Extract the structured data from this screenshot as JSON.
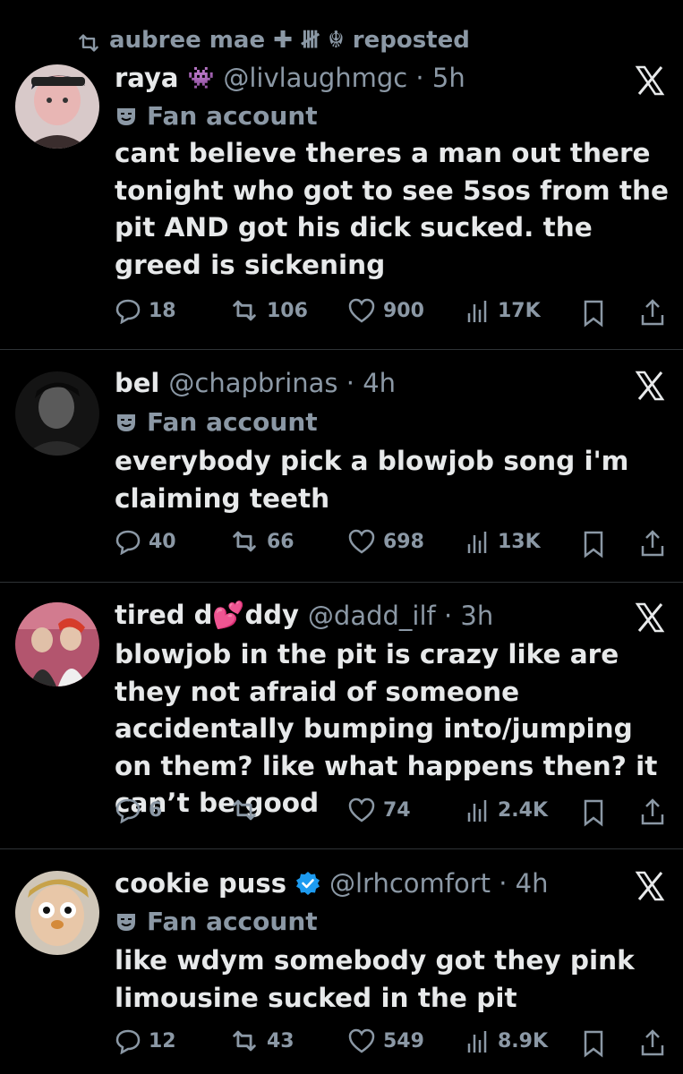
{
  "repost_banner": {
    "text": "aubree mae ✚ 𝍸 ☬ reposted"
  },
  "tweets": [
    {
      "name": "raya",
      "name_emoji": "👾",
      "handle": "@livlaughmgc",
      "time": "5h",
      "fan_label": "Fan account",
      "text": "cant believe theres a man out there tonight who got to see 5sos from the pit AND got his dick sucked. the greed is sickening",
      "replies": "18",
      "reposts": "106",
      "likes": "900",
      "views": "17K"
    },
    {
      "name": "bel",
      "handle": "@chapbrinas",
      "time": "4h",
      "fan_label": "Fan account",
      "text": "everybody pick a blowjob song i'm claiming teeth",
      "replies": "40",
      "reposts": "66",
      "likes": "698",
      "views": "13K"
    },
    {
      "name_part1": "tired d",
      "name_emoji": "💕",
      "name_part2": "ddy",
      "handle": "@dadd_ilf",
      "time": "3h",
      "text": "blowjob in the pit is crazy like are they not afraid of someone accidentally bumping into/jumping on them? like what happens then? it can’t be good",
      "replies": "6",
      "reposts": "",
      "likes": "74",
      "views": "2.4K"
    },
    {
      "name": "cookie puss",
      "handle": "@lrhcomfort",
      "time": "4h",
      "fan_label": "Fan account",
      "text": "like wdym somebody got they pink limousine sucked in the pit",
      "replies": "12",
      "reposts": "43",
      "likes": "549",
      "views": "8.9K"
    }
  ],
  "colors": {
    "background": "#000000",
    "text": "#e7e9ea",
    "muted": "#8b98a5",
    "verified": "#1d9bf0",
    "divider": "#2f3336"
  }
}
